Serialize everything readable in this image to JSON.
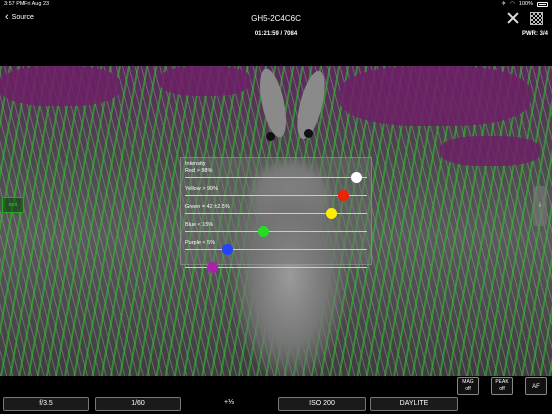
{
  "status": {
    "time": "3:57 PM",
    "date": "Fri Aug 23",
    "battery": "100%"
  },
  "nav": {
    "back_label": "Source",
    "title": "GH5-2C4C6C"
  },
  "info": {
    "timecode": "01:21:59 / 7084",
    "power": "PWR: 3/4"
  },
  "side": {
    "right_label": "i"
  },
  "panel": {
    "title": "Intensity",
    "rows": [
      {
        "label": "Red > 98%",
        "color": "#ffffff",
        "level": 0.94
      },
      {
        "label": "Yellow > 90%",
        "color": "#ee2200",
        "level": 0.87
      },
      {
        "label": "Green = 42 ±2.5%",
        "color": "#ffee00",
        "level": 0.8
      },
      {
        "label": "Blue < 15%",
        "color": "#22dd22",
        "level": 0.43
      },
      {
        "label": "Purple < 5%",
        "color": "#2244ff",
        "level": 0.23
      },
      {
        "label": "",
        "color": "#aa22aa",
        "level": 0.15
      }
    ]
  },
  "bottom": {
    "mag": {
      "line1": "MAG",
      "line2": "off"
    },
    "peak": {
      "line1": "PEAK",
      "line2": "off"
    },
    "af": "AF",
    "aperture": "f/3.5",
    "shutter": "1/60",
    "ev": "+⅓",
    "iso": "ISO 200",
    "wb": "DAYLITE"
  },
  "icons": {
    "back": "chevron-left-icon",
    "close": "close-icon",
    "grid": "checker-grid-icon",
    "airplane": "airplane-icon",
    "wifi": "wifi-icon",
    "battery": "battery-icon"
  }
}
